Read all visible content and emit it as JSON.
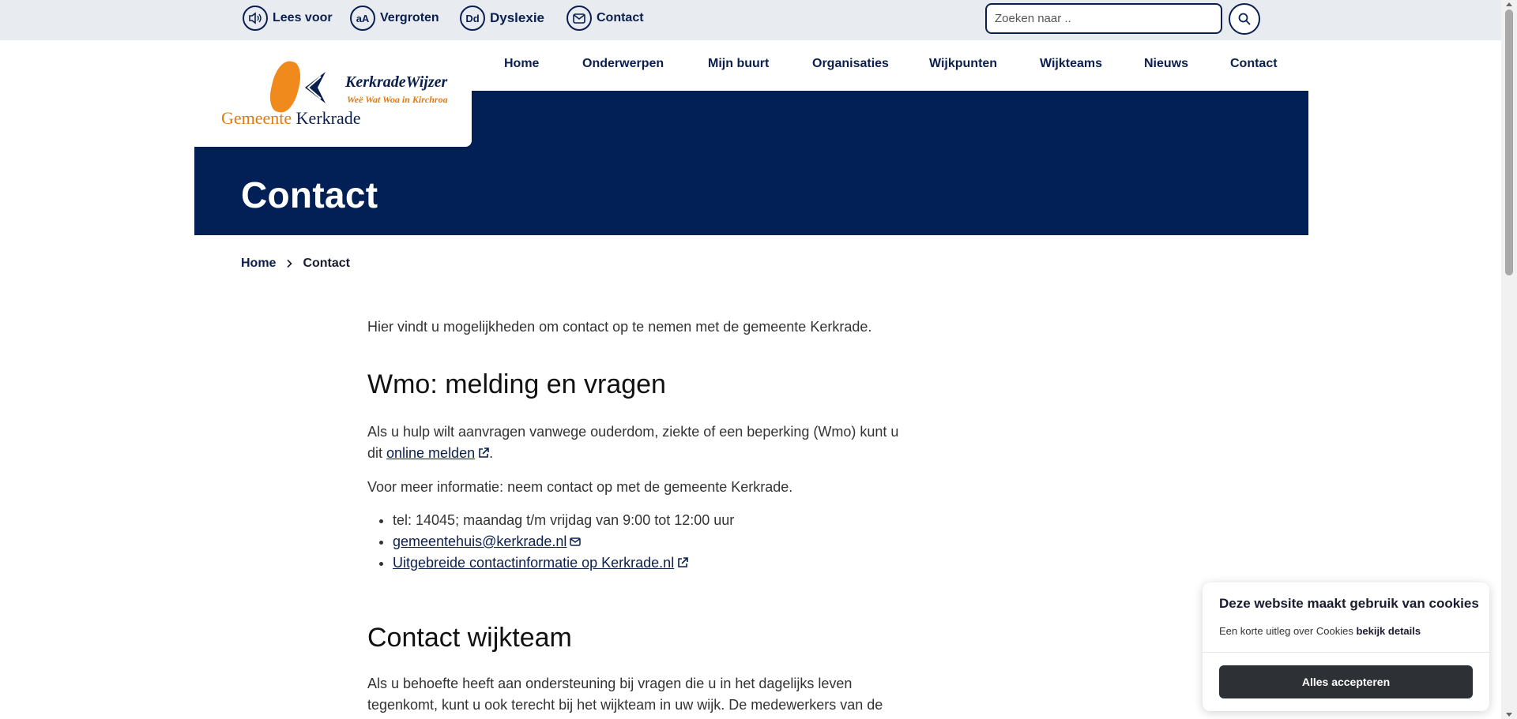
{
  "utility_bar": {
    "read_aloud": "Lees voor",
    "enlarge": "Vergroten",
    "enlarge_icon_text": "aA",
    "dyslexia": "Dyslexie",
    "dyslexia_icon_text": "Dd",
    "contact": "Contact",
    "search_placeholder": "Zoeken naar .."
  },
  "logo": {
    "name": "KerkradeWijzer",
    "tagline": "Weë Wat Woa in Kirchroa",
    "municipality_prefix": "Gemeente",
    "municipality_name": "Kerkrade"
  },
  "nav": {
    "items": [
      {
        "label": "Home"
      },
      {
        "label": "Onderwerpen"
      },
      {
        "label": "Mijn buurt"
      },
      {
        "label": "Organisaties"
      },
      {
        "label": "Wijkpunten"
      },
      {
        "label": "Wijkteams"
      },
      {
        "label": "Nieuws"
      },
      {
        "label": "Contact"
      }
    ]
  },
  "hero": {
    "title": "Contact"
  },
  "breadcrumb": {
    "home": "Home",
    "current": "Contact"
  },
  "content": {
    "intro": "Hier vindt u mogelijkheden om contact op te nemen met de gemeente Kerkrade.",
    "section1": {
      "heading": "Wmo: melding en vragen",
      "para1_before": "Als u hulp wilt aanvragen vanwege ouderdom, ziekte of een beperking (Wmo) kunt u dit ",
      "para1_link": "online melden",
      "para1_after": ".",
      "para2": "Voor meer informatie: neem contact op met de gemeente Kerkrade.",
      "list": {
        "phone": "tel: 14045; maandag t/m vrijdag van 9:00 tot 12:00 uur",
        "email": "gemeentehuis@kerkrade.nl",
        "more": "Uitgebreide contactinformatie op Kerkrade.nl"
      }
    },
    "section2": {
      "heading": "Contact wijkteam",
      "para": "Als u behoefte heeft aan ondersteuning bij vragen die u in het dagelijks leven tegenkomt, kunt u ook terecht bij het wijkteam in uw wijk. De medewerkers van de"
    }
  },
  "cookie": {
    "title": "Deze website maakt gebruik van cookies",
    "text": "Een korte uitleg over Cookies",
    "details_link": "bekijk details",
    "accept_button": "Alles accepteren"
  },
  "colors": {
    "navy": "#032056",
    "text_navy": "#0b1f4f",
    "orange": "#f08a1c",
    "topbar": "#e8ebf0",
    "cookie_button": "#2d3035"
  }
}
